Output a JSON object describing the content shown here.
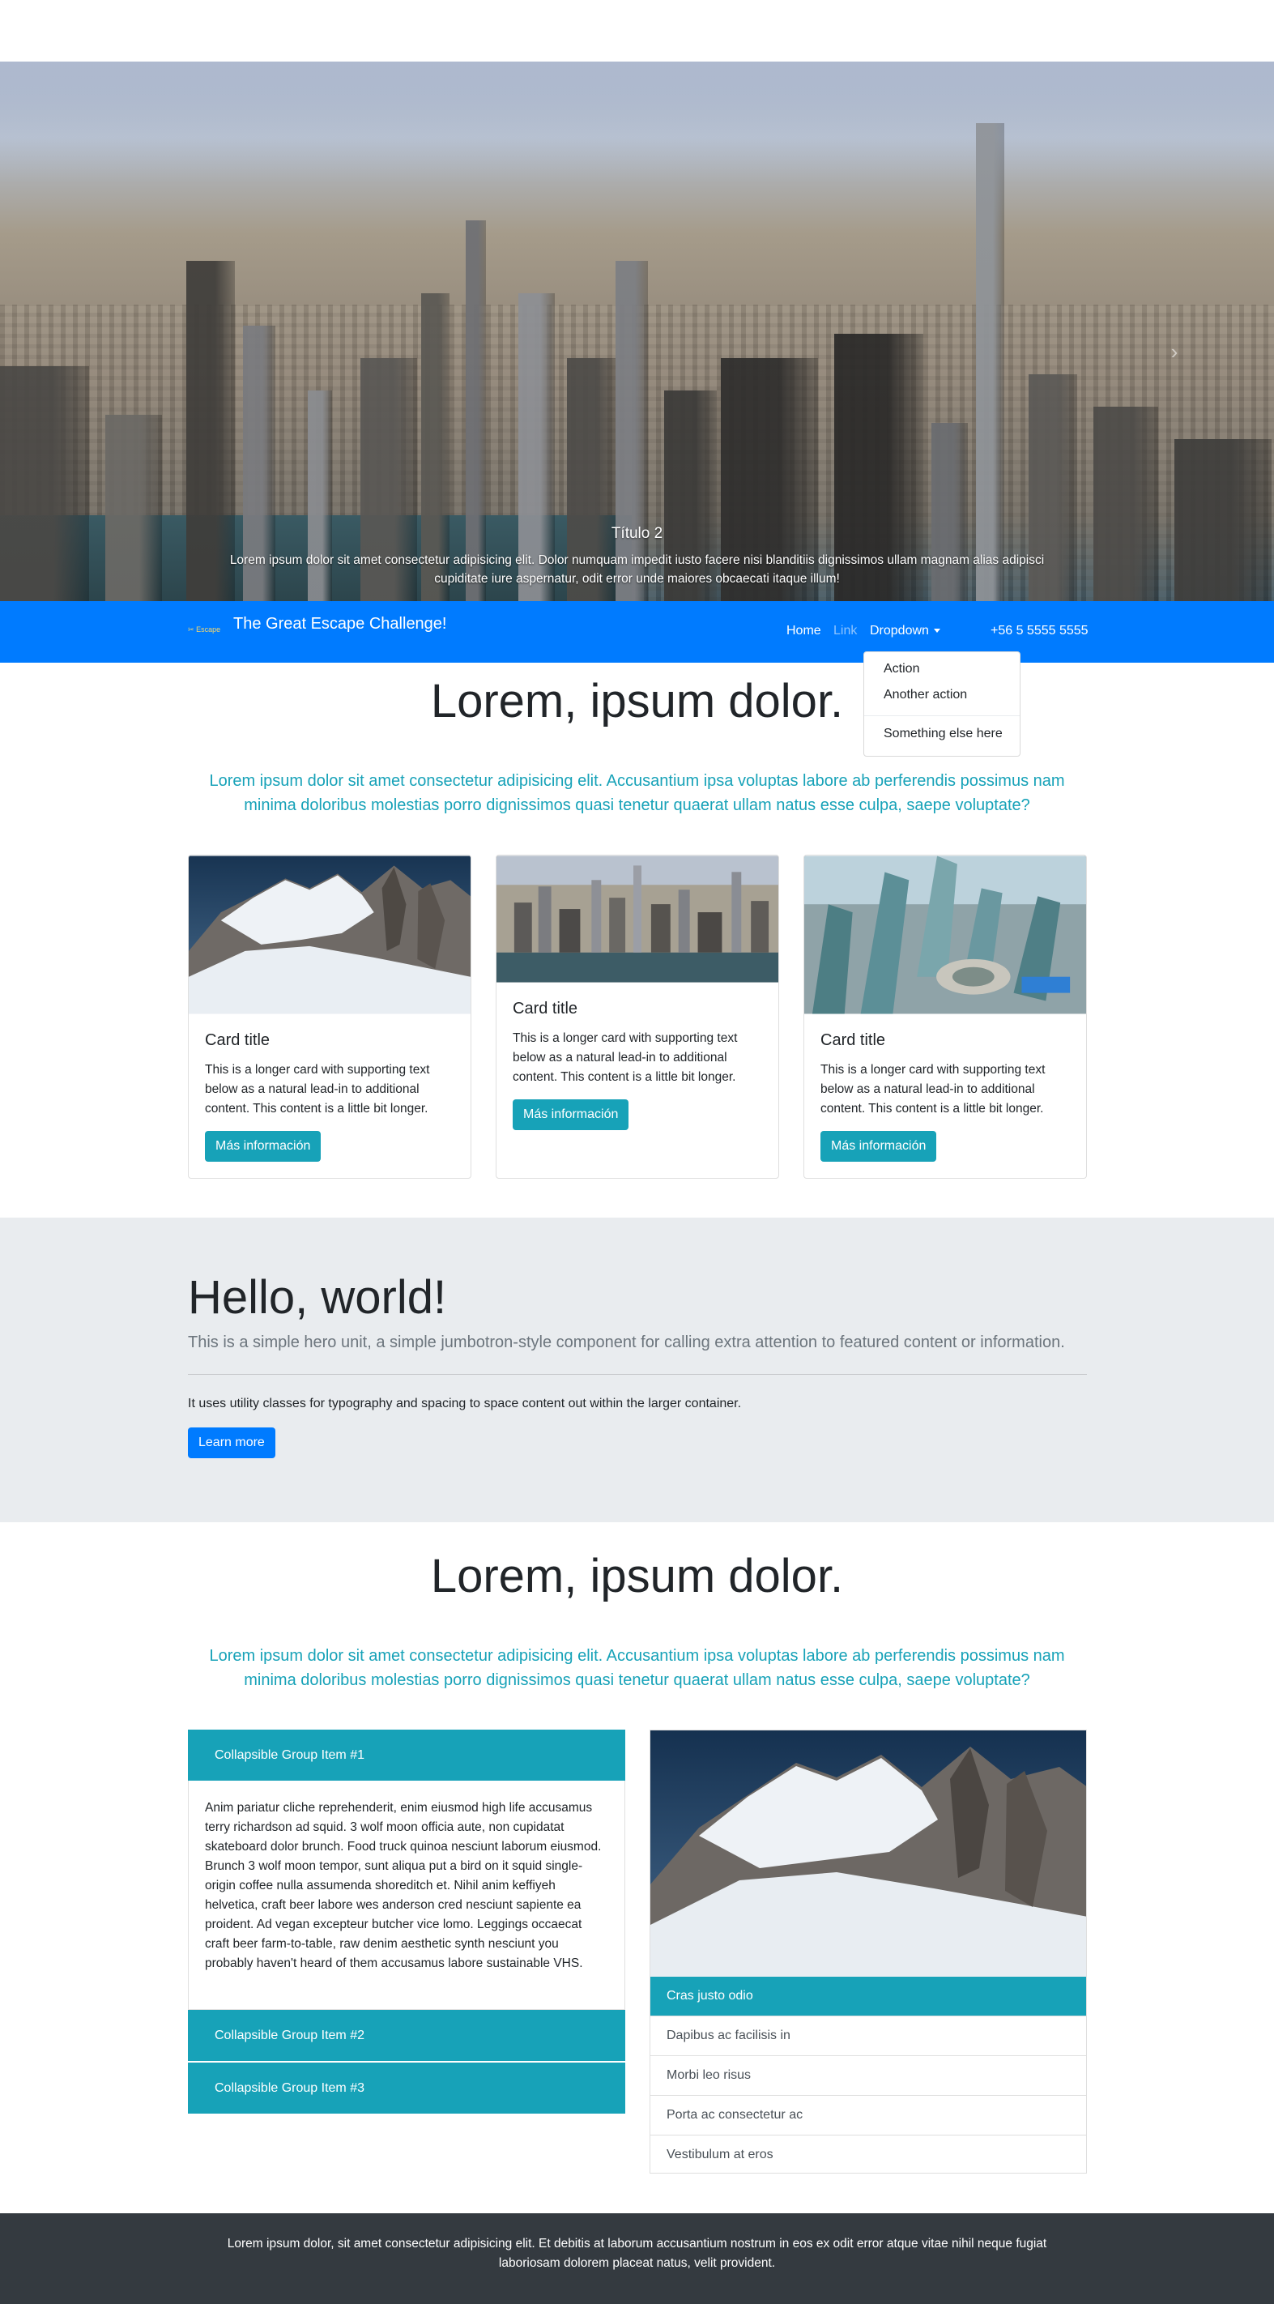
{
  "hero": {
    "caption_title": "Título 2",
    "caption_text": "Lorem ipsum dolor sit amet consectetur adipisicing elit. Dolor numquam impedit iusto facere nisi blanditiis dignissimos ullam magnam alias adipisci cupiditate iure aspernatur, odit error unde maiores obcaecati itaque illum!",
    "next_icon": "chevron-right-icon"
  },
  "navbar": {
    "brand_mini": "Escape",
    "brand_name": "The Great Escape Challenge!",
    "links": [
      "Home",
      "Link",
      "Dropdown"
    ],
    "phone": "+56 5 5555 5555",
    "dropdown_items": [
      "Action",
      "Another action",
      "Something else here"
    ],
    "bg_color": "#007bff"
  },
  "section1": {
    "title": "Lorem, ipsum dolor.",
    "lead": "Lorem ipsum dolor sit amet consectetur adipisicing elit. Accusantium ipsa voluptas labore ab perferendis possimus nam minima doloribus molestias porro dignissimos quasi tenetur quaerat ullam natus esse culpa, saepe voluptate?"
  },
  "cards": [
    {
      "image": "snowy-mountain",
      "title": "Card title",
      "text": "This is a longer card with supporting text below as a natural lead-in to additional content. This content is a little bit longer.",
      "button": "Más información"
    },
    {
      "image": "city-skyline",
      "title": "Card title",
      "text": "This is a longer card with supporting text below as a natural lead-in to additional content. This content is a little bit longer.",
      "button": "Más información"
    },
    {
      "image": "city-aerial",
      "title": "Card title",
      "text": "This is a longer card with supporting text below as a natural lead-in to additional content. This content is a little bit longer.",
      "button": "Más información"
    }
  ],
  "jumbotron": {
    "title": "Hello, world!",
    "lead": "This is a simple hero unit, a simple jumbotron-style component for calling extra attention to featured content or information.",
    "text": "It uses utility classes for typography and spacing to space content out within the larger container.",
    "button": "Learn more"
  },
  "section2": {
    "title": "Lorem, ipsum dolor.",
    "lead": "Lorem ipsum dolor sit amet consectetur adipisicing elit. Accusantium ipsa voluptas labore ab perferendis possimus nam minima doloribus molestias porro dignissimos quasi tenetur quaerat ullam natus esse culpa, saepe voluptate?"
  },
  "accordion": {
    "items": [
      "Collapsible Group Item #1",
      "Collapsible Group Item #2",
      "Collapsible Group Item #3"
    ],
    "body": "Anim pariatur cliche reprehenderit, enim eiusmod high life accusamus terry richardson ad squid. 3 wolf moon officia aute, non cupidatat skateboard dolor brunch. Food truck quinoa nesciunt laborum eiusmod. Brunch 3 wolf moon tempor, sunt aliqua put a bird on it squid single-origin coffee nulla assumenda shoreditch et. Nihil anim keffiyeh helvetica, craft beer labore wes anderson cred nesciunt sapiente ea proident. Ad vegan excepteur butcher vice lomo. Leggings occaecat craft beer farm-to-table, raw denim aesthetic synth nesciunt you probably haven't heard of them accusamus labore sustainable VHS."
  },
  "panel": {
    "image": "snowy-mountain",
    "header": "Cras justo odio",
    "items": [
      "Dapibus ac facilisis in",
      "Morbi leo risus",
      "Porta ac consectetur ac",
      "Vestibulum at eros"
    ]
  },
  "footer": {
    "text": "Lorem ipsum dolor, sit amet consectetur adipisicing elit. Et debitis at laborum accusantium nostrum in eos ex odit error atque vitae nihil neque fugiat laboriosam dolorem placeat natus, velit provident."
  },
  "colors": {
    "primary": "#007bff",
    "info": "#17a2b8",
    "dark": "#343a40",
    "light": "#e9ecef"
  }
}
